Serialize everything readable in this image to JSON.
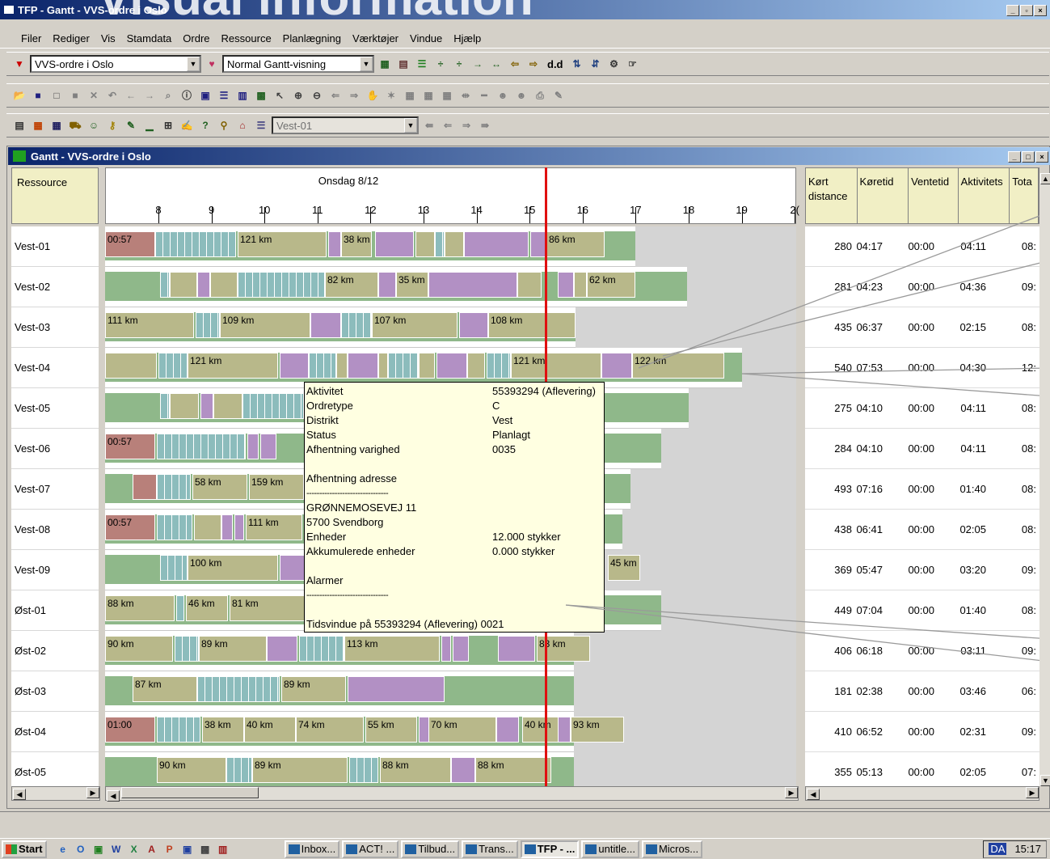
{
  "app_title": "TFP - Gantt - VVS-ordre i Oslo",
  "watermark": "Visual information",
  "menu": [
    "Filer",
    "Rediger",
    "Vis",
    "Stamdata",
    "Ordre",
    "Ressource",
    "Planlægning",
    "Værktøjer",
    "Vindue",
    "Hjælp"
  ],
  "toolbar": {
    "plan_combo": "VVS-ordre i Oslo",
    "view_combo": "Normal Gantt-visning",
    "dd_label": "d.d",
    "resource_combo": "Vest-01"
  },
  "window_title": "Gantt - VVS-ordre i Oslo",
  "resource_header": "Ressource",
  "day_label": "Onsdag 8/12",
  "hours": [
    "8",
    "9",
    "10",
    "11",
    "12",
    "13",
    "14",
    "15",
    "16",
    "17",
    "18",
    "19",
    "2("
  ],
  "resources": [
    "Vest-01",
    "Vest-02",
    "Vest-03",
    "Vest-04",
    "Vest-05",
    "Vest-06",
    "Vest-07",
    "Vest-08",
    "Vest-09",
    "Øst-01",
    "Øst-02",
    "Øst-03",
    "Øst-04",
    "Øst-05"
  ],
  "bar_labels": {
    "r0": [
      "00:57",
      "121 km",
      "38 km",
      "86 km"
    ],
    "r1": [
      "82 km",
      "35 km",
      "62 km"
    ],
    "r2": [
      "111 km",
      "109 km",
      "107 km",
      "108 km"
    ],
    "r3": [
      "121 km",
      "121 km",
      "122 km"
    ],
    "r5": [
      "00:57"
    ],
    "r6": [
      "58 km",
      "159 km"
    ],
    "r7": [
      "00:57",
      "111 km"
    ],
    "r8": [
      "100 km",
      "45 km"
    ],
    "r9": [
      "88 km",
      "46 km",
      "81 km"
    ],
    "r10": [
      "90 km",
      "89 km",
      "113 km",
      "83 km"
    ],
    "r11": [
      "87 km",
      "89 km"
    ],
    "r12": [
      "01:00",
      "38 km",
      "40 km",
      "74 km",
      "55 km",
      "70 km",
      "40 km",
      "93 km"
    ],
    "r13": [
      "90 km",
      "89 km",
      "88 km",
      "88 km"
    ]
  },
  "tooltip": {
    "aktivitet_l": "Aktivitet",
    "aktivitet_v": "55393294 (Aflevering)",
    "ordretype_l": "Ordretype",
    "ordretype_v": "C",
    "distrikt_l": "Distrikt",
    "distrikt_v": "Vest",
    "status_l": "Status",
    "status_v": "Planlagt",
    "varighed_l": "Afhentning varighed",
    "varighed_v": "0035",
    "adresse_l": "Afhentning adresse",
    "sep": "--------------------------------",
    "street": "GRØNNEMOSEVEJ 11",
    "city": "5700 Svendborg",
    "enheder_l": "Enheder",
    "enheder_v": "12.000 stykker",
    "akk_l": "Akkumulerede enheder",
    "akk_v": "0.000 stykker",
    "alarmer_l": "Alarmer",
    "window": "Tidsvindue på 55393294 (Aflevering) 0021"
  },
  "stats_headers": [
    "Kørt distance",
    "Køretid",
    "Ventetid",
    "Aktivitets",
    "Tota"
  ],
  "stats": [
    [
      "280",
      "04:17",
      "00:00",
      "04:11",
      "08:"
    ],
    [
      "281",
      "04:23",
      "00:00",
      "04:36",
      "09:"
    ],
    [
      "435",
      "06:37",
      "00:00",
      "02:15",
      "08:"
    ],
    [
      "540",
      "07:53",
      "00:00",
      "04:30",
      "12:"
    ],
    [
      "275",
      "04:10",
      "00:00",
      "04:11",
      "08:"
    ],
    [
      "284",
      "04:10",
      "00:00",
      "04:11",
      "08:"
    ],
    [
      "493",
      "07:16",
      "00:00",
      "01:40",
      "08:"
    ],
    [
      "438",
      "06:41",
      "00:00",
      "02:05",
      "08:"
    ],
    [
      "369",
      "05:47",
      "00:00",
      "03:20",
      "09:"
    ],
    [
      "449",
      "07:04",
      "00:00",
      "01:40",
      "08:"
    ],
    [
      "406",
      "06:18",
      "00:00",
      "03:11",
      "09:"
    ],
    [
      "181",
      "02:38",
      "00:00",
      "03:46",
      "06:"
    ],
    [
      "410",
      "06:52",
      "00:00",
      "02:31",
      "09:"
    ],
    [
      "355",
      "05:13",
      "00:00",
      "02:05",
      "07:"
    ]
  ],
  "taskbar": {
    "start": "Start",
    "tasks": [
      "Inbox...",
      "ACT! ...",
      "Tilbud...",
      "Trans...",
      "TFP - ...",
      "untitle...",
      "Micros..."
    ],
    "tray": "DA",
    "clock": "15:17"
  },
  "colors": {
    "drive": "#b8b88a",
    "stop_purple": "#b290c4",
    "stop_teal": "#8cbcbc",
    "idle_green": "#8fb88a",
    "late_red": "#b8807a",
    "now_line": "#e01010"
  }
}
